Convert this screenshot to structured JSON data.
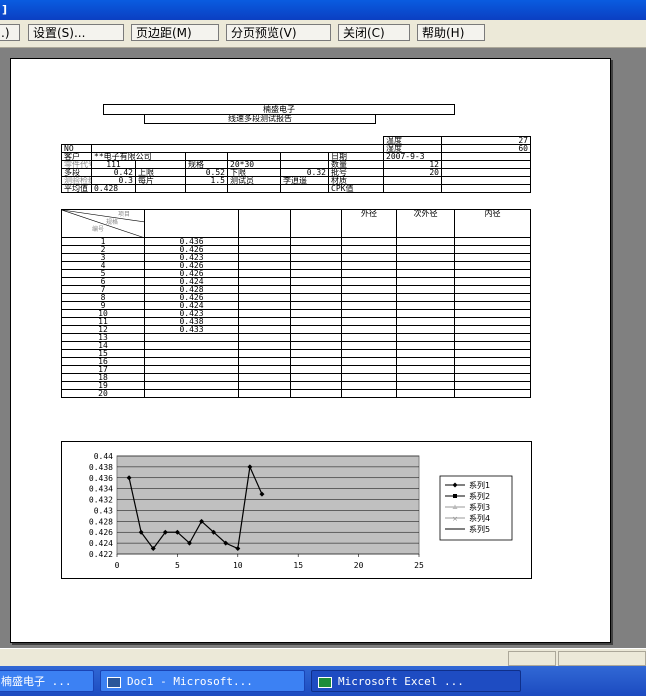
{
  "window": {
    "title": "]"
  },
  "toolbar": {
    "buttons": [
      ".) ",
      "设置(S)...",
      "页边距(M)",
      "分页预览(V)",
      "关闭(C)",
      "帮助(H)"
    ]
  },
  "report": {
    "company": "楠盛电子",
    "title": "线速多段测试报告",
    "temp_label": "温度",
    "temp_value": "27",
    "humid_label": "湿度",
    "humid_value": "60",
    "no_label": "NO",
    "customer_label": "客户",
    "customer_value": "**电子有限公司",
    "date_label": "日期",
    "date_value": "2007-9-3",
    "part_label": "零件代号",
    "part_value": "111",
    "spec_label": "规格",
    "spec_value": "20*30",
    "qty_label": "数量",
    "qty_value": "12",
    "ratio_label": "多段",
    "ratio_value": "0.42",
    "upper_label": "上限",
    "upper_value": "0.52",
    "lower_label": "下限",
    "lower_value": "0.32",
    "code_label": "批号",
    "code_value": "20",
    "line_label": "测验检线",
    "line_value": "0.3",
    "pieces_label": "每片",
    "pieces_value": "1.5",
    "tester_label": "测试员",
    "tester_value": "李逍遥",
    "material_label": "材质",
    "avg_label": "平均值",
    "avg_value": "0.428",
    "cpk_label": "CPK值",
    "header_item": "项目",
    "header_test": "规格",
    "header_num": "编号",
    "col_outer": "外径",
    "col_second": "次外径",
    "col_inner": "内径",
    "rows": [
      {
        "n": "1",
        "v": "0.436"
      },
      {
        "n": "2",
        "v": "0.426"
      },
      {
        "n": "3",
        "v": "0.423"
      },
      {
        "n": "4",
        "v": "0.426"
      },
      {
        "n": "5",
        "v": "0.426"
      },
      {
        "n": "6",
        "v": "0.424"
      },
      {
        "n": "7",
        "v": "0.428"
      },
      {
        "n": "8",
        "v": "0.426"
      },
      {
        "n": "9",
        "v": "0.424"
      },
      {
        "n": "10",
        "v": "0.423"
      },
      {
        "n": "11",
        "v": "0.438"
      },
      {
        "n": "12",
        "v": "0.433"
      },
      {
        "n": "13",
        "v": ""
      },
      {
        "n": "14",
        "v": ""
      },
      {
        "n": "15",
        "v": ""
      },
      {
        "n": "16",
        "v": ""
      },
      {
        "n": "17",
        "v": ""
      },
      {
        "n": "18",
        "v": ""
      },
      {
        "n": "19",
        "v": ""
      },
      {
        "n": "20",
        "v": ""
      }
    ]
  },
  "chart_data": {
    "type": "line",
    "x": [
      1,
      2,
      3,
      4,
      5,
      6,
      7,
      8,
      9,
      10,
      11,
      12
    ],
    "series": [
      {
        "name": "系列1",
        "values": [
          0.436,
          0.426,
          0.423,
          0.426,
          0.426,
          0.424,
          0.428,
          0.426,
          0.424,
          0.423,
          0.438,
          0.433
        ]
      },
      {
        "name": "系列2",
        "values": []
      },
      {
        "name": "系列3",
        "values": []
      },
      {
        "name": "系列4",
        "values": []
      },
      {
        "name": "系列5",
        "values": []
      }
    ],
    "xlim": [
      0,
      25
    ],
    "ylim": [
      0.422,
      0.44
    ],
    "xticks": [
      "0",
      "5",
      "10",
      "15",
      "20",
      "25"
    ],
    "yticks": [
      "0.44",
      "0.438",
      "0.436",
      "0.434",
      "0.432",
      "0.43",
      "0.428",
      "0.426",
      "0.424",
      "0.422"
    ],
    "grid": true,
    "legend": "right",
    "plot_bg": "#c0c0c0"
  },
  "taskbar": {
    "items": [
      "楠盛电子 ...",
      "Doc1 - Microsoft...",
      "Microsoft Excel ..."
    ]
  }
}
